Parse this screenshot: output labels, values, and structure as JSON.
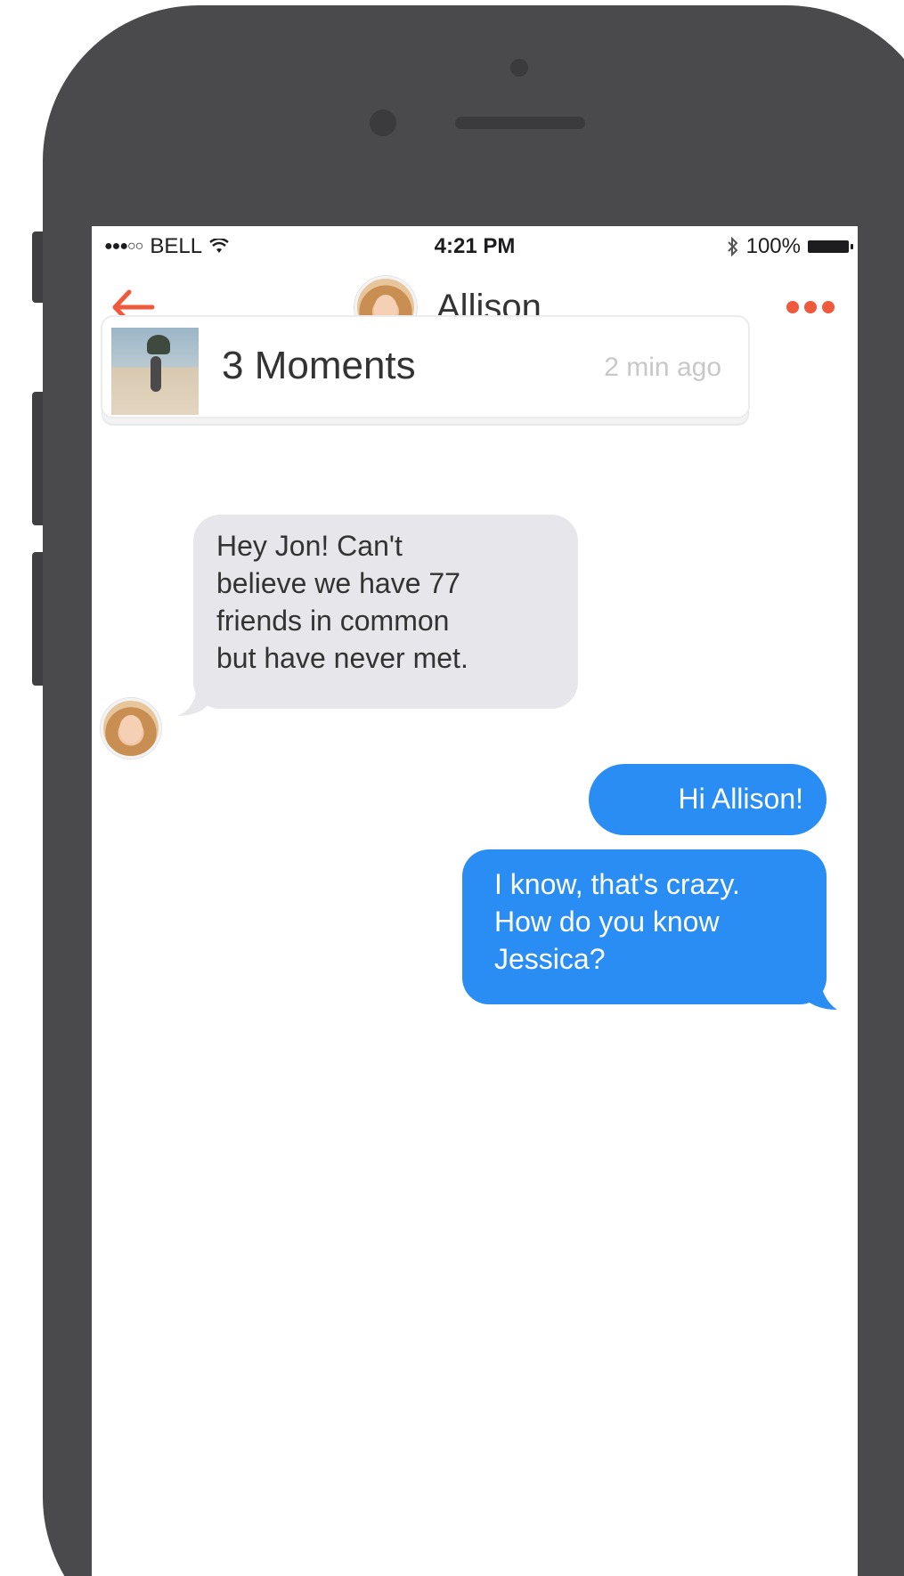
{
  "status_bar": {
    "carrier": "BELL",
    "signal_dots": "●●●○○",
    "time": "4:21 PM",
    "battery": "100%"
  },
  "nav": {
    "title": "Allison",
    "accent_color": "#f05a3c"
  },
  "moments_card": {
    "title": "3 Moments",
    "timestamp": "2 min ago"
  },
  "messages": [
    {
      "direction": "incoming",
      "lines": [
        "Hey Jon! Can't",
        "believe we have 77",
        "friends in common",
        "but have never met."
      ]
    },
    {
      "direction": "outgoing",
      "lines": [
        "Hi Allison!"
      ]
    },
    {
      "direction": "outgoing",
      "lines": [
        "I know, that's crazy.",
        "How do you know",
        "Jessica?"
      ]
    }
  ],
  "colors": {
    "incoming_bubble": "#e6e6eb",
    "outgoing_bubble": "#2a8df4",
    "phone_body": "#4a4a4c"
  }
}
